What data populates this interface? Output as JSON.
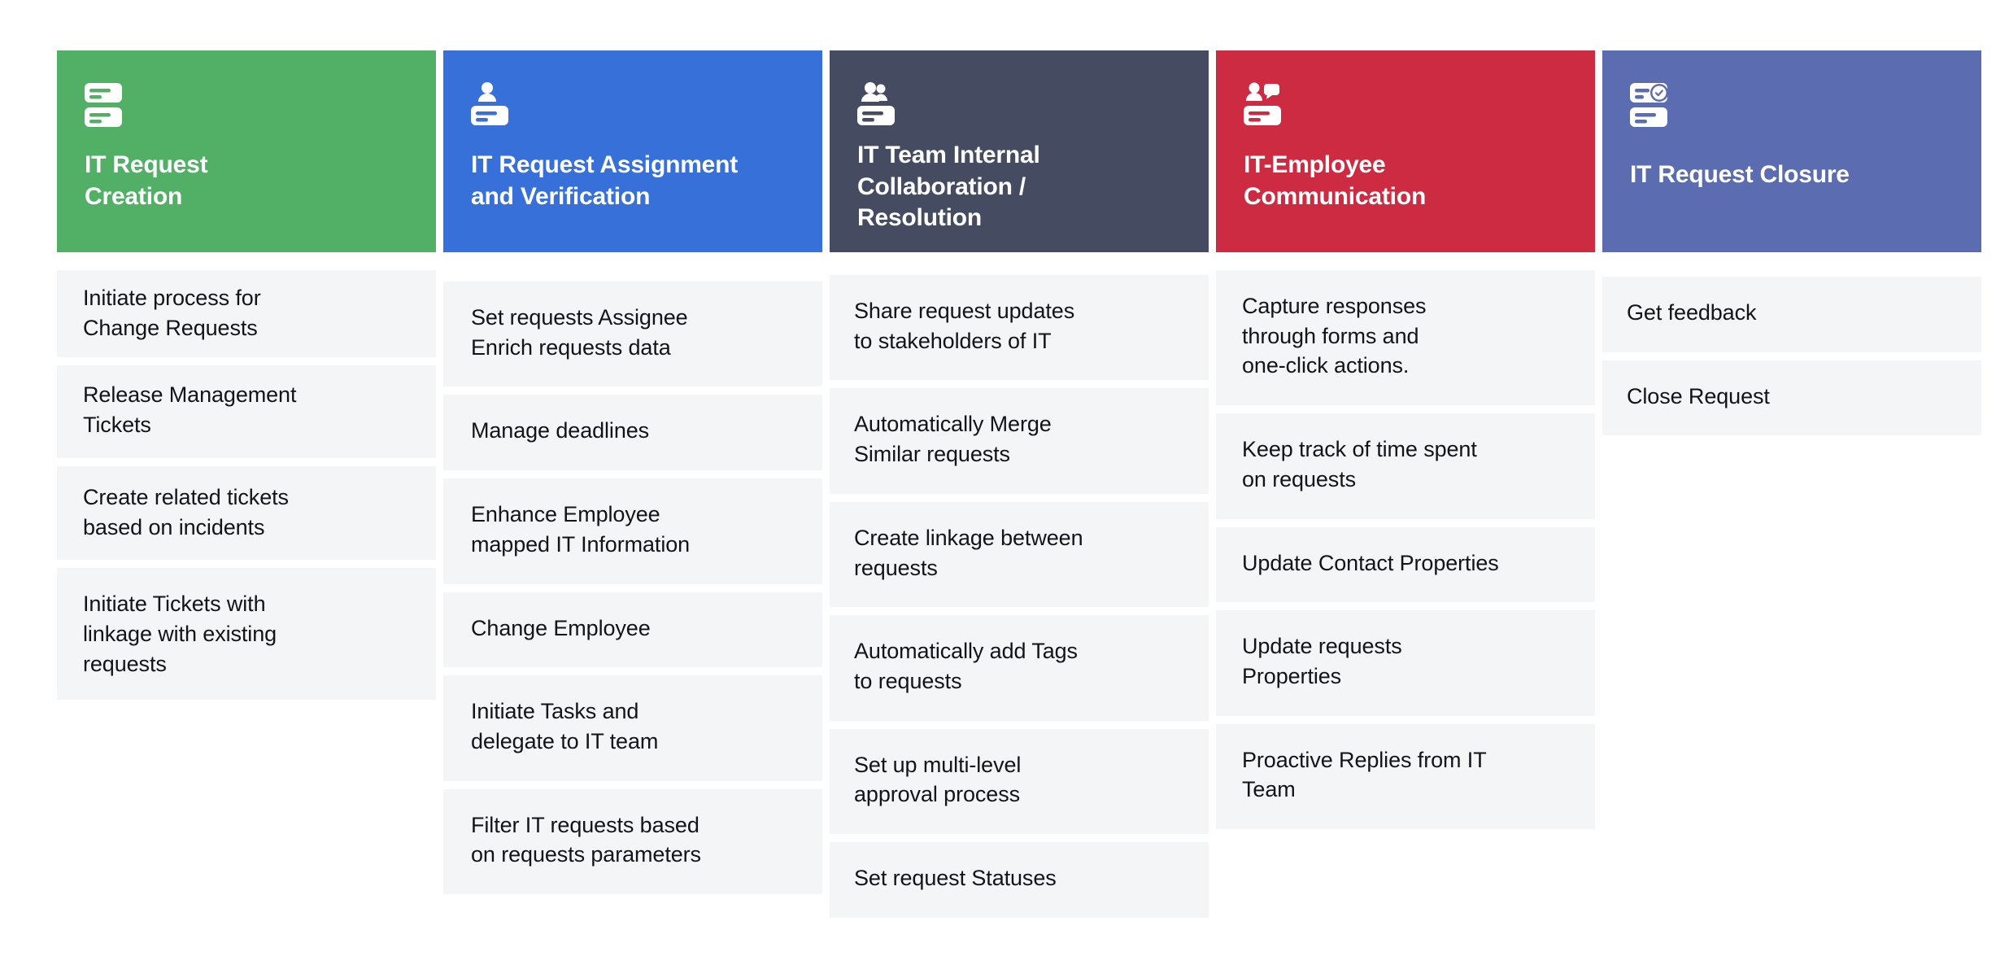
{
  "board": {
    "stage_count": 5,
    "background_color": "#ffffff",
    "item_background_color": "#f4f5f7",
    "item_text_color": "#111418"
  },
  "stages": [
    {
      "id": "it-request-creation",
      "title": "IT Request\nCreation",
      "title_lines": 2,
      "header_color": "#51AF66",
      "icon": "ticket-stack-icon",
      "items": [
        "Initiate process for\nChange Requests",
        "Release Management\nTickets",
        "Create related tickets\nbased on incidents",
        "Initiate Tickets with\nlinkage with existing\nrequests"
      ]
    },
    {
      "id": "it-request-assignment-and-verification",
      "title": "IT Request Assignment\nand Verification",
      "title_lines": 2,
      "header_color": "#3670D8",
      "icon": "person-ticket-icon",
      "items": [
        "Set requests Assignee\nEnrich requests data",
        "Manage deadlines",
        "Enhance Employee\nmapped IT  Information",
        "Change Employee",
        "Initiate Tasks and\ndelegate to IT team",
        "Filter IT requests based\non requests parameters"
      ]
    },
    {
      "id": "it-team-internal-collaboration-resolution",
      "title": "IT Team Internal\nCollaboration /\nResolution",
      "title_lines": 3,
      "header_color": "#454C61",
      "icon": "people-ticket-icon",
      "items": [
        "Share request updates\nto stakeholders of IT",
        "Automatically Merge\nSimilar requests",
        "Create linkage between\nrequests",
        "Automatically add Tags\nto requests",
        "Set up multi-level\napproval process",
        "Set request Statuses"
      ]
    },
    {
      "id": "it-employee-communication",
      "title": "IT-Employee\nCommunication",
      "title_lines": 2,
      "header_color": "#CC2B41",
      "icon": "people-chat-ticket-icon",
      "items": [
        "Capture responses\nthrough forms and\none-click actions.",
        "Keep track of time spent\non requests",
        "Update Contact Properties",
        "Update requests\nProperties",
        "Proactive Replies from IT\nTeam"
      ]
    },
    {
      "id": "it-request-closure",
      "title": "IT Request Closure",
      "title_lines": 1,
      "header_color": "#5C6CB0",
      "icon": "ticket-check-icon",
      "items": [
        "Get feedback",
        "Close Request"
      ]
    }
  ]
}
